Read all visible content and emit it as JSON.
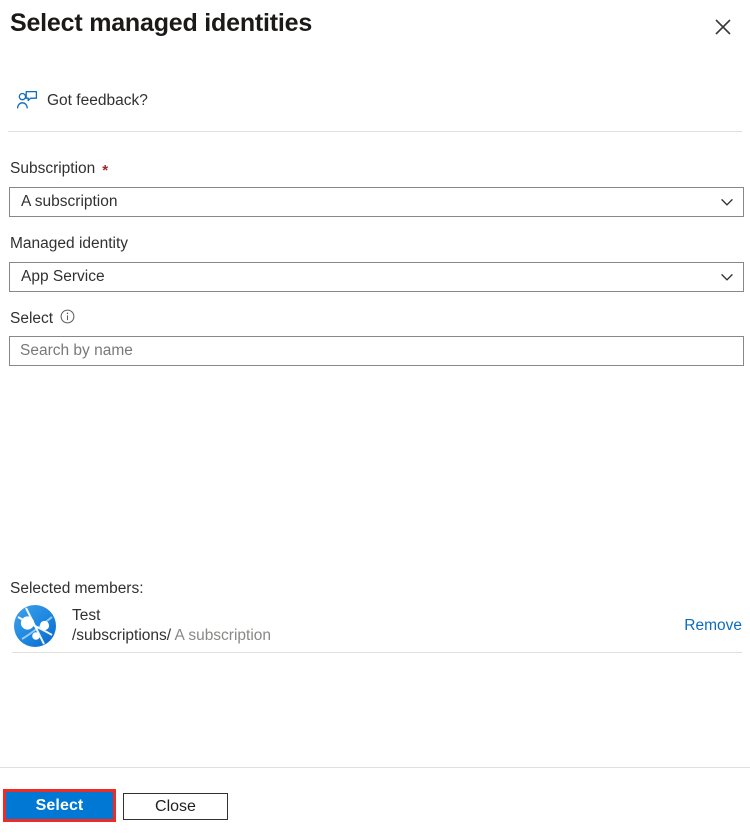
{
  "panel": {
    "title": "Select managed identities",
    "close_icon": "close-icon"
  },
  "feedback": {
    "label": "Got feedback?",
    "icon": "feedback-person-icon"
  },
  "form": {
    "subscription": {
      "label": "Subscription",
      "required_marker": "*",
      "value": "A subscription",
      "chevron_icon": "chevron-down-icon"
    },
    "managed_identity": {
      "label": "Managed identity",
      "value": "App Service",
      "chevron_icon": "chevron-down-icon"
    },
    "select": {
      "label": "Select",
      "info_icon": "info-icon",
      "search_value": "",
      "search_placeholder": "Search by name"
    }
  },
  "selected_members": {
    "heading": "Selected members:",
    "items": [
      {
        "avatar_icon": "app-service-icon",
        "name": "Test",
        "scope_prefix": "/subscriptions/",
        "scope_value": " A subscription",
        "remove_label": "Remove"
      }
    ]
  },
  "footer": {
    "select_label": "Select",
    "close_label": "Close"
  },
  "colors": {
    "primary_button": "#0078d4",
    "highlight_border": "#ef2b25",
    "link": "#0f6cbd",
    "required": "#a4262c",
    "border": "#8a8886",
    "divider": "#e1dfdd"
  }
}
